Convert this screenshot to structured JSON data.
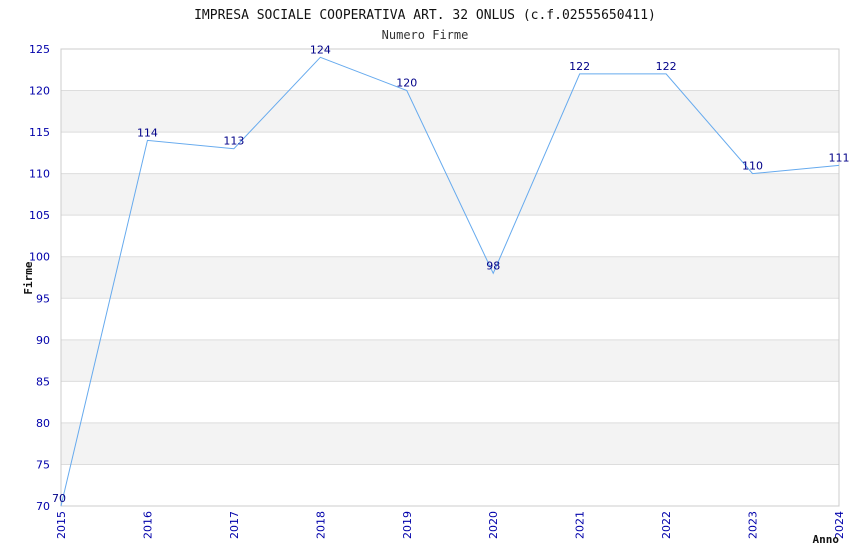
{
  "chart_data": {
    "type": "line",
    "title": "IMPRESA SOCIALE COOPERATIVA ART. 32 ONLUS (c.f.02555650411)",
    "subtitle": "Numero Firme",
    "xlabel": "Anno",
    "ylabel": "Firme",
    "x": [
      "2015",
      "2016",
      "2017",
      "2018",
      "2019",
      "2020",
      "2021",
      "2022",
      "2023",
      "2024"
    ],
    "series": [
      {
        "values": [
          70,
          114,
          113,
          124,
          120,
          98,
          122,
          122,
          110,
          111
        ]
      }
    ],
    "ylim": [
      70,
      125
    ],
    "yticks": [
      70,
      75,
      80,
      85,
      90,
      95,
      100,
      105,
      110,
      115,
      120,
      125
    ],
    "grid": true,
    "line_color": "#66aaee",
    "tick_color": "#0000aa",
    "label_color": "#000088",
    "band_color": "#f3f3f3"
  }
}
